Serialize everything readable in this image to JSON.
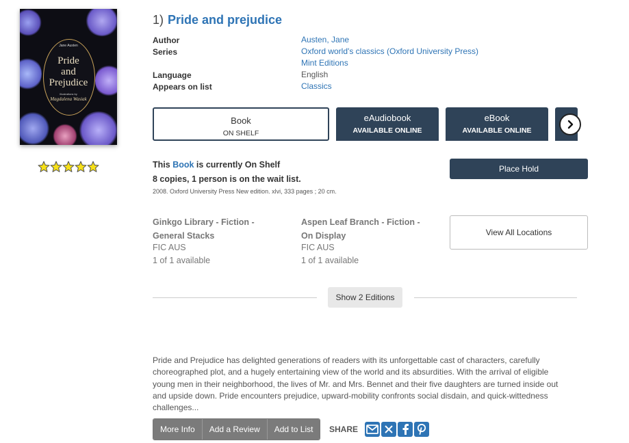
{
  "result": {
    "index": "1)",
    "title": "Pride and prejudice",
    "rating_stars": 5,
    "cover": {
      "author": "Jane Austen",
      "title_line1": "Pride",
      "title_line2": "and",
      "title_line3": "Prejudice",
      "illus": "Illustrations by",
      "illustrator": "Magdalena Wasiak"
    }
  },
  "meta": {
    "author_label": "Author",
    "author_value": "Austen, Jane",
    "series_label": "Series",
    "series_value_1": "Oxford world's classics (Oxford University Press)",
    "series_value_2": "Mint Editions",
    "language_label": "Language",
    "language_value": "English",
    "list_label": "Appears on list",
    "list_value": "Classics"
  },
  "formats": [
    {
      "name": "Book",
      "status": "ON SHELF"
    },
    {
      "name": "eAudiobook",
      "status": "AVAILABLE ONLINE"
    },
    {
      "name": "eBook",
      "status": "AVAILABLE ONLINE"
    }
  ],
  "availability": {
    "prefix": "This",
    "format": "Book",
    "suffix": "is currently On Shelf",
    "copies": "8 copies, 1 person is on the wait list.",
    "edition_note": "2008. Oxford University Press New edition. xlvi, 333 pages ; 20 cm.",
    "place_hold": "Place Hold",
    "view_all_locations": "View All Locations",
    "show_editions": "Show 2 Editions"
  },
  "locations": [
    {
      "name_line1": "Ginkgo Library - Fiction -",
      "name_line2": "General Stacks",
      "call_number": "FIC AUS",
      "available": "1 of 1 available"
    },
    {
      "name_line1": "Aspen Leaf Branch - Fiction -",
      "name_line2": "On Display",
      "call_number": "FIC AUS",
      "available": "1 of 1 available"
    }
  ],
  "summary": "Pride and Prejudice has delighted generations of readers with its unforgettable cast of characters, carefully choreographed plot, and a hugely entertaining view of the world and its absurdities. With the arrival of eligible young men in their neighborhood, the lives of Mr. and Mrs. Bennet and their five daughters are turned inside out and upside down. Pride encounters prejudice, upward-mobility confronts social disdain, and quick-wittedness challenges...",
  "actions": {
    "more_info": "More Info",
    "add_review": "Add a Review",
    "add_to_list": "Add to List",
    "share": "SHARE"
  },
  "share_icons": [
    "email-icon",
    "x-twitter-icon",
    "facebook-icon",
    "pinterest-icon"
  ],
  "colors": {
    "link": "#2e74b5",
    "dark_button": "#2f4358",
    "action_gray": "#7b7b7b"
  }
}
